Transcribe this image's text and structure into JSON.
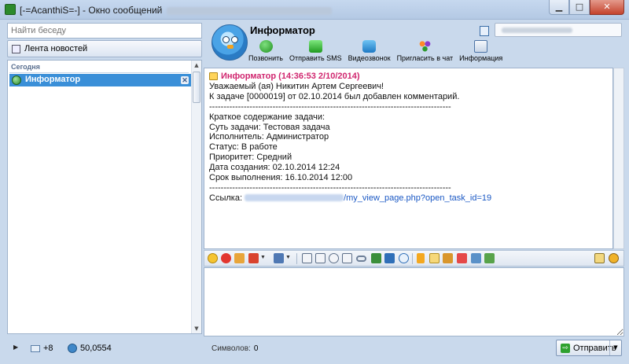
{
  "window": {
    "title": "[-=AcanthiS=-] - Окно сообщений",
    "minimize_glyph": "▁",
    "maximize_glyph": "□",
    "close_glyph": "✕"
  },
  "sidebar": {
    "search_placeholder": "Найти беседу",
    "news_button": "Лента новостей",
    "group_label": "Сегодня",
    "conversations": [
      {
        "label": "Информатор",
        "close_glyph": "✕"
      }
    ],
    "status": {
      "expand_glyph": "▶",
      "mail_count": "+8",
      "balance": "50,0554"
    }
  },
  "contact": {
    "name": "Информатор",
    "actions": [
      {
        "label": "Позвонить",
        "icon": "phone-icon"
      },
      {
        "label": "Отправить SMS",
        "icon": "sms-icon"
      },
      {
        "label": "Видеозвонок",
        "icon": "video-icon"
      },
      {
        "label": "Пригласить в чат",
        "icon": "invite-icon"
      },
      {
        "label": "Информация",
        "icon": "info-icon"
      }
    ]
  },
  "message": {
    "header": "Информатор (14:36:53 2/10/2014)",
    "lines": [
      "Уважаемый (ая) Никитин Артем Сергеевич!",
      "К задаче [0000019] от 02.10.2014 был добавлен комментарий.",
      "------------------------------------------------------------------------------------",
      "Краткое содержание задачи:",
      "",
      "Суть задачи: Тестовая задача",
      "Исполнитель: Администратор",
      "Статус: В работе",
      "Приоритет: Средний",
      "Дата создания: 02.10.2014 12:24",
      "Срок выполнения: 16.10.2014 12:00",
      "------------------------------------------------------------------------------------"
    ],
    "link_label": "Ссылка:",
    "link_path": "/my_view_page.php?open_task_id=19"
  },
  "composer": {
    "char_counter_label": "Символов:",
    "char_count": "0",
    "send_label": "Отправить",
    "send_glyph": "⇨",
    "dropdown_glyph": "▼"
  }
}
